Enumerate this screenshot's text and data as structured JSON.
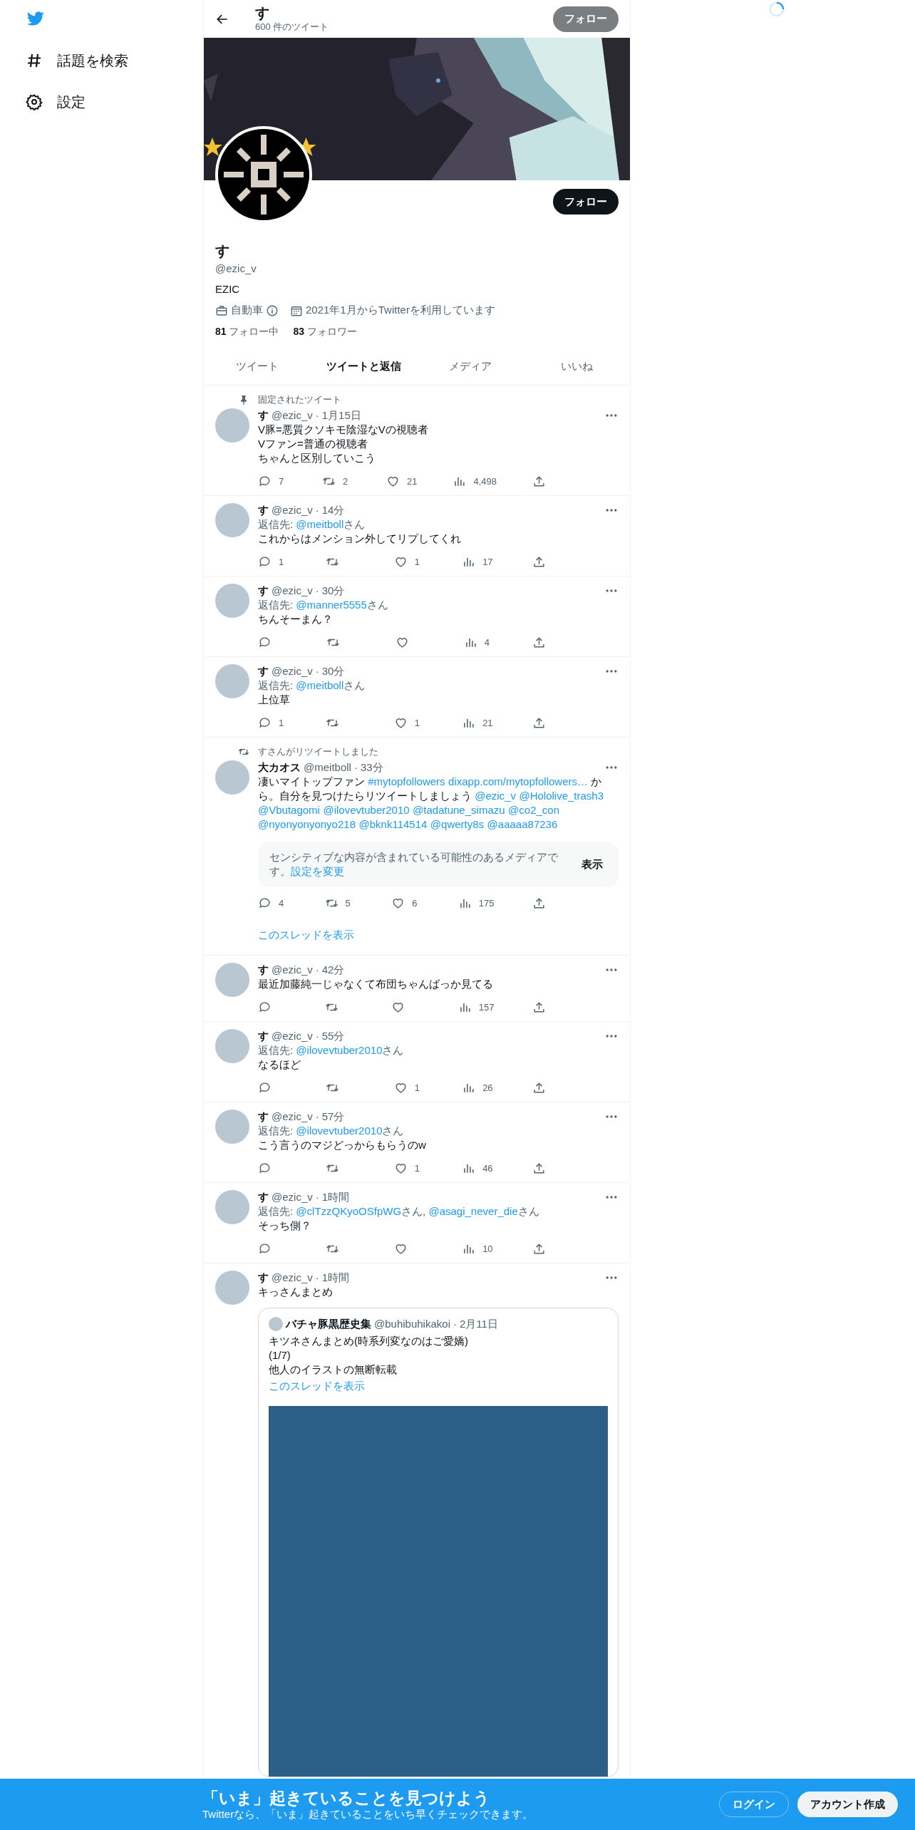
{
  "sidebar": {
    "items": [
      {
        "label": "話題を検索"
      },
      {
        "label": "設定"
      }
    ]
  },
  "header": {
    "title": "す",
    "subtitle": "600 件のツイート",
    "follow_button": "フォロー"
  },
  "profile": {
    "name": "す",
    "handle": "@ezic_v",
    "bio": "EZIC",
    "category": "自動車",
    "joined": "2021年1月からTwitterを利用しています",
    "following_count": "81",
    "following_label": "フォロー中",
    "followers_count": "83",
    "followers_label": "フォロワー",
    "follow_button": "フォロー"
  },
  "tabs": [
    {
      "label": "ツイート",
      "selected": false
    },
    {
      "label": "ツイートと返信",
      "selected": true
    },
    {
      "label": "メディア",
      "selected": false
    },
    {
      "label": "いいね",
      "selected": false
    }
  ],
  "tweets": [
    {
      "context": {
        "kind": "pinned",
        "text": "固定されたツイート"
      },
      "name": "す",
      "handle": "@ezic_v",
      "dot": "·",
      "time": "1月15日",
      "lines": [
        "V豚=悪質クソキモ陰湿なVの視聴者",
        "Vファン=普通の視聴者",
        "ちゃんと区別していこう"
      ],
      "actions": [
        {
          "kind": "reply",
          "count": "7"
        },
        {
          "kind": "retweet",
          "count": "2"
        },
        {
          "kind": "like",
          "count": "21"
        },
        {
          "kind": "views",
          "count": "4,498"
        },
        {
          "kind": "share"
        }
      ]
    },
    {
      "name": "す",
      "handle": "@ezic_v",
      "dot": "·",
      "time": "14分",
      "reply_to": [
        {
          "kind": "text",
          "text": "返信先: "
        },
        {
          "kind": "mention",
          "text": "@meitboll"
        },
        {
          "kind": "text",
          "text": "さん"
        }
      ],
      "lines": [
        "これからはメンション外してリプしてくれ"
      ],
      "actions": [
        {
          "kind": "reply",
          "count": "1"
        },
        {
          "kind": "retweet"
        },
        {
          "kind": "like",
          "count": "1"
        },
        {
          "kind": "views",
          "count": "17"
        },
        {
          "kind": "share"
        }
      ]
    },
    {
      "name": "す",
      "handle": "@ezic_v",
      "dot": "·",
      "time": "30分",
      "reply_to": [
        {
          "kind": "text",
          "text": "返信先: "
        },
        {
          "kind": "mention",
          "text": "@manner5555"
        },
        {
          "kind": "text",
          "text": "さん"
        }
      ],
      "lines": [
        "ちんそーまん？"
      ],
      "actions": [
        {
          "kind": "reply"
        },
        {
          "kind": "retweet"
        },
        {
          "kind": "like"
        },
        {
          "kind": "views",
          "count": "4"
        },
        {
          "kind": "share"
        }
      ]
    },
    {
      "name": "す",
      "handle": "@ezic_v",
      "dot": "·",
      "time": "30分",
      "reply_to": [
        {
          "kind": "text",
          "text": "返信先: "
        },
        {
          "kind": "mention",
          "text": "@meitboll"
        },
        {
          "kind": "text",
          "text": "さん"
        }
      ],
      "lines": [
        "上位草"
      ],
      "actions": [
        {
          "kind": "reply",
          "count": "1"
        },
        {
          "kind": "retweet"
        },
        {
          "kind": "like",
          "count": "1"
        },
        {
          "kind": "views",
          "count": "21"
        },
        {
          "kind": "share"
        }
      ]
    },
    {
      "context": {
        "kind": "retweet",
        "text": "すさんがリツイートしました"
      },
      "name": "大カオス",
      "handle": "@meitboll",
      "dot": "·",
      "time": "33分",
      "segments": [
        {
          "kind": "text",
          "text": "凄いマイトップファン "
        },
        {
          "kind": "hashtag",
          "text": "#mytopfollowers"
        },
        {
          "kind": "url",
          "text": "dixapp.com/mytopfollowers…"
        },
        {
          "kind": "text",
          "text": " から。自分を見つけたらリツイートしましょう "
        },
        {
          "kind": "mention",
          "text": "@ezic_v"
        },
        {
          "kind": "mention",
          "text": "@Hololive_trash3"
        },
        {
          "kind": "mention",
          "text": "@Vbutagomi"
        },
        {
          "kind": "mention",
          "text": "@ilovevtuber2010"
        },
        {
          "kind": "mention",
          "text": "@tadatune_simazu"
        },
        {
          "kind": "mention",
          "text": "@co2_con"
        },
        {
          "kind": "mention",
          "text": "@nyonyonyonyo218"
        },
        {
          "kind": "mention",
          "text": "@bknk114514"
        },
        {
          "kind": "mention",
          "text": "@qwerty8s"
        },
        {
          "kind": "mention",
          "text": "@aaaaa87236"
        }
      ],
      "sensitive": {
        "text": "センシティブな内容が含まれている可能性のあるメディアです。",
        "link": "設定を変更",
        "button": "表示"
      },
      "actions": [
        {
          "kind": "reply",
          "count": "4"
        },
        {
          "kind": "retweet",
          "count": "5"
        },
        {
          "kind": "like",
          "count": "6"
        },
        {
          "kind": "views",
          "count": "175"
        },
        {
          "kind": "share"
        }
      ],
      "thread_link": "このスレッドを表示"
    },
    {
      "name": "す",
      "handle": "@ezic_v",
      "dot": "·",
      "time": "42分",
      "lines": [
        "最近加藤純一じゃなくて布団ちゃんばっか見てる"
      ],
      "actions": [
        {
          "kind": "reply"
        },
        {
          "kind": "retweet"
        },
        {
          "kind": "like"
        },
        {
          "kind": "views",
          "count": "157"
        },
        {
          "kind": "share"
        }
      ]
    },
    {
      "name": "す",
      "handle": "@ezic_v",
      "dot": "·",
      "time": "55分",
      "reply_to": [
        {
          "kind": "text",
          "text": "返信先: "
        },
        {
          "kind": "mention",
          "text": "@ilovevtuber2010"
        },
        {
          "kind": "text",
          "text": "さん"
        }
      ],
      "lines": [
        "なるほど"
      ],
      "actions": [
        {
          "kind": "reply"
        },
        {
          "kind": "retweet"
        },
        {
          "kind": "like",
          "count": "1"
        },
        {
          "kind": "views",
          "count": "26"
        },
        {
          "kind": "share"
        }
      ]
    },
    {
      "name": "す",
      "handle": "@ezic_v",
      "dot": "·",
      "time": "57分",
      "reply_to": [
        {
          "kind": "text",
          "text": "返信先: "
        },
        {
          "kind": "mention",
          "text": "@ilovevtuber2010"
        },
        {
          "kind": "text",
          "text": "さん"
        }
      ],
      "lines": [
        "こう言うのマジどっからもらうのw"
      ],
      "actions": [
        {
          "kind": "reply"
        },
        {
          "kind": "retweet"
        },
        {
          "kind": "like",
          "count": "1"
        },
        {
          "kind": "views",
          "count": "46"
        },
        {
          "kind": "share"
        }
      ]
    },
    {
      "name": "す",
      "handle": "@ezic_v",
      "dot": "·",
      "time": "1時間",
      "reply_to": [
        {
          "kind": "text",
          "text": "返信先: "
        },
        {
          "kind": "mention",
          "text": "@clTzzQKyoOSfpWG"
        },
        {
          "kind": "text",
          "text": "さん, "
        },
        {
          "kind": "mention",
          "text": "@asagi_never_die"
        },
        {
          "kind": "text",
          "text": "さん"
        }
      ],
      "lines": [
        "そっち側？"
      ],
      "actions": [
        {
          "kind": "reply"
        },
        {
          "kind": "retweet"
        },
        {
          "kind": "like"
        },
        {
          "kind": "views",
          "count": "10"
        },
        {
          "kind": "share"
        }
      ]
    },
    {
      "name": "す",
      "handle": "@ezic_v",
      "dot": "·",
      "time": "1時間",
      "lines": [
        "キっさんまとめ"
      ],
      "quote": {
        "name": "バチャ豚黒歴史集",
        "handle": "@buhibuhikakoi",
        "dot": "·",
        "time": "2月11日",
        "lines": [
          "キツネさんまとめ(時系列変なのはご愛嬌)",
          "(1/7)",
          "他人のイラストの無断転載"
        ],
        "thread_link": "このスレッドを表示",
        "media": {
          "kind": "placeholder"
        }
      }
    }
  ],
  "signup_bar": {
    "title": "「いま」起きていることを見つけよう",
    "subtitle": "Twitterなら、「いま」起きていることをいち早くチェックできます。",
    "login_button": "ログイン",
    "signup_button": "アカウント作成"
  }
}
